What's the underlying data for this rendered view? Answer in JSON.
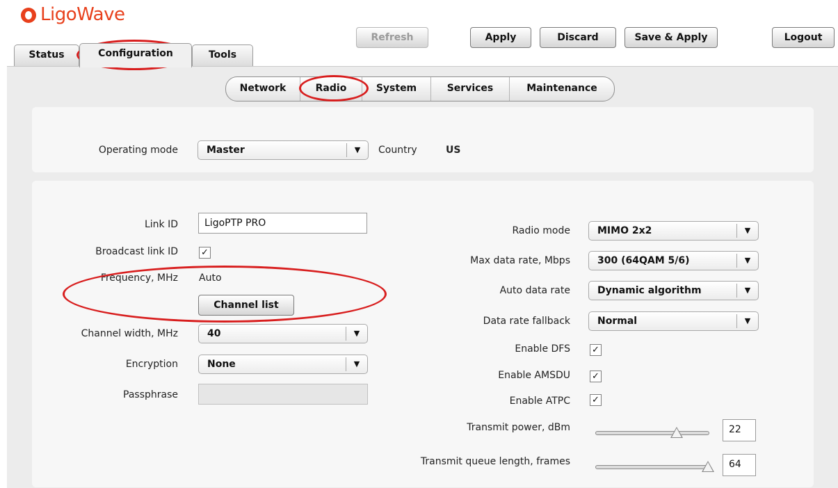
{
  "brand": {
    "name": "LigoWave"
  },
  "tabs": [
    {
      "label": "Status"
    },
    {
      "label": "Configuration"
    },
    {
      "label": "Tools"
    }
  ],
  "actions": {
    "refresh": "Refresh",
    "apply": "Apply",
    "discard": "Discard",
    "save_apply": "Save & Apply",
    "logout": "Logout"
  },
  "subtabs": [
    {
      "label": "Network"
    },
    {
      "label": "Radio"
    },
    {
      "label": "System"
    },
    {
      "label": "Services"
    },
    {
      "label": "Maintenance"
    }
  ],
  "general": {
    "operating_mode_label": "Operating mode",
    "operating_mode_value": "Master",
    "country_label": "Country",
    "country_value": "US"
  },
  "left": {
    "link_id_label": "Link ID",
    "link_id_value": "LigoPTP PRO",
    "broadcast_label": "Broadcast link ID",
    "broadcast_checked": true,
    "frequency_label": "Frequency, MHz",
    "frequency_value": "Auto",
    "channel_list_button": "Channel list",
    "channel_width_label": "Channel width, MHz",
    "channel_width_value": "40",
    "encryption_label": "Encryption",
    "encryption_value": "None",
    "passphrase_label": "Passphrase",
    "passphrase_value": ""
  },
  "right": {
    "radio_mode_label": "Radio mode",
    "radio_mode_value": "MIMO 2x2",
    "max_rate_label": "Max data rate, Mbps",
    "max_rate_value": "300 (64QAM 5/6)",
    "auto_rate_label": "Auto data rate",
    "auto_rate_value": "Dynamic algorithm",
    "fallback_label": "Data rate fallback",
    "fallback_value": "Normal",
    "dfs_label": "Enable DFS",
    "amsdu_label": "Enable AMSDU",
    "atpc_label": "Enable ATPC",
    "tx_power_label": "Transmit power, dBm",
    "tx_power_value": "22",
    "tx_power_fraction": 0.72,
    "tx_queue_label": "Transmit queue length, frames",
    "tx_queue_value": "64",
    "tx_queue_fraction": 1.0
  },
  "check_mark": "✓",
  "arrow_glyph": "▼",
  "colors": {
    "accent": "#e8401c",
    "highlight": "#d81e1e"
  }
}
